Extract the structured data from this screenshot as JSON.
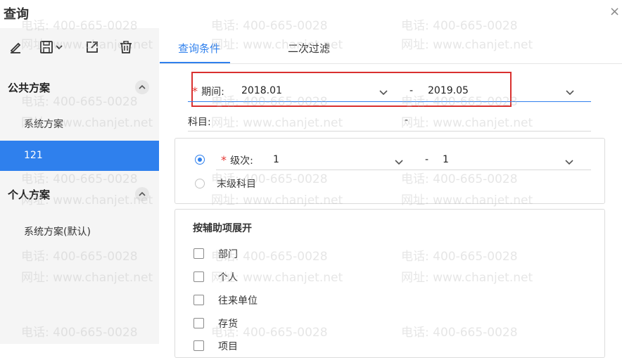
{
  "window": {
    "title": "查询",
    "close_glyph": "×"
  },
  "toolbar": {
    "edit_icon": "pencil-icon",
    "save_icon": "save-icon",
    "export_icon": "export-icon",
    "delete_icon": "trash-icon"
  },
  "public_schemes": {
    "title": "公共方案",
    "items": [
      {
        "label": "系统方案"
      },
      {
        "label": "121",
        "active": true
      }
    ]
  },
  "personal_schemes": {
    "title": "个人方案",
    "items": [
      {
        "label": "系统方案(默认)"
      }
    ]
  },
  "tabs": [
    {
      "label": "查询条件",
      "active": true
    },
    {
      "label": "二次过滤"
    }
  ],
  "period": {
    "required_mark": "*",
    "label": "期间:",
    "from": "2018.01",
    "separator": "-",
    "to": "2019.05"
  },
  "subject": {
    "label": "科目:",
    "separator": "-"
  },
  "level": {
    "required_mark": "*",
    "label": "级次:",
    "from": "1",
    "separator": "-",
    "to": "1",
    "leaf_option_label": "末级科目"
  },
  "aux_expand": {
    "title": "按辅助项展开",
    "items": [
      "部门",
      "个人",
      "往来单位",
      "存货",
      "项目"
    ]
  },
  "watermark": {
    "phone": "电话: 400-665-0028",
    "site": "网址: www.chanjet.net"
  },
  "colors": {
    "accent": "#2f80ed",
    "highlight_border": "#d9302f",
    "required": "#e53935"
  }
}
